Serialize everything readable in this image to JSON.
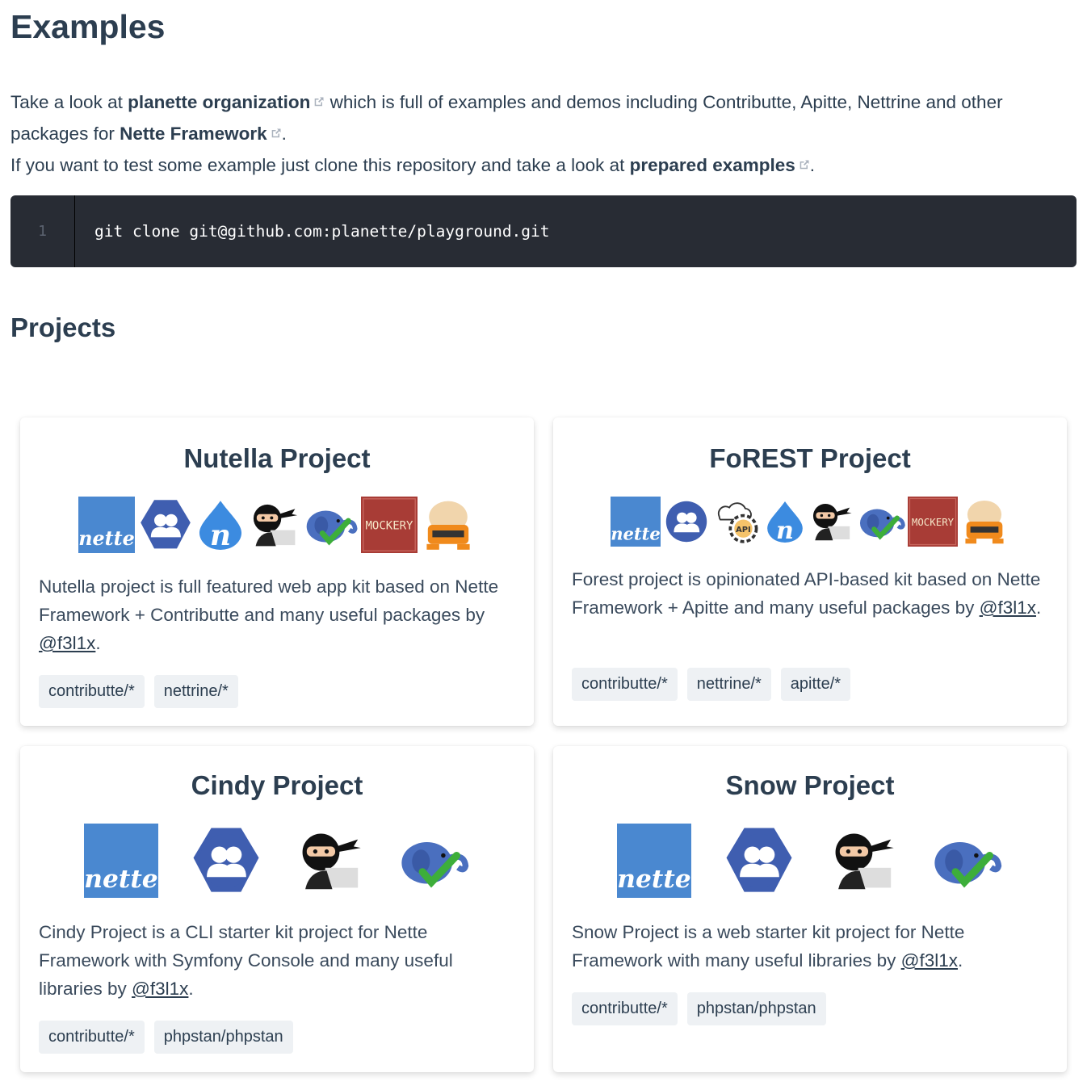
{
  "page": {
    "heading": "Examples",
    "intro": {
      "p1_a": "Take a look at ",
      "p1_link1": "planette organization",
      "p1_b": " which is full of examples and demos including Contributte, Apitte, Nettrine and other packages for ",
      "p1_link2": "Nette Framework",
      "p1_c": ".",
      "p2_a": "If you want to test some example just clone this repository and take a look at ",
      "p2_link": "prepared examples",
      "p2_b": "."
    },
    "code": {
      "line_number": "1",
      "text": "git clone git@github.com:planette/playground.git"
    },
    "projects_heading": "Projects"
  },
  "logo_texts": {
    "nette": "nette",
    "mockery": "MOCKERY",
    "api": "API",
    "n": "n"
  },
  "icons": [
    "external-link-icon",
    "nette-logo",
    "contributte-logo",
    "nettrine-logo",
    "apitte-logo",
    "ninja-logo",
    "phpstan-elephant-logo",
    "mockery-logo",
    "robot-logo"
  ],
  "colors": {
    "text": "#2c3e50",
    "code_bg": "#282c34",
    "tag_bg": "#eef1f4",
    "nette_blue": "#4a88d0",
    "contributte_blue": "#3f5eb0",
    "mockery_red": "#a83c36"
  },
  "cards": [
    {
      "title": "Nutella Project",
      "desc": "Nutella project is full featured web app kit based on Nette Framework + Contributte and many useful packages by ",
      "author": "@f3l1x",
      "end": ".",
      "tags": [
        "contributte/*",
        "nettrine/*"
      ]
    },
    {
      "title": "FoREST Project",
      "desc": "Forest project is opinionated API-based kit based on Nette Framework + Apitte and many useful packages by ",
      "author": "@f3l1x",
      "end": ".",
      "tags": [
        "contributte/*",
        "nettrine/*",
        "apitte/*"
      ]
    },
    {
      "title": "Cindy Project",
      "desc": "Cindy Project is a CLI starter kit project for Nette Framework with Symfony Console and many useful libraries by ",
      "author": "@f3l1x",
      "end": ".",
      "tags": [
        "contributte/*",
        "phpstan/phpstan"
      ]
    },
    {
      "title": "Snow Project",
      "desc": "Snow Project is a web starter kit project for Nette Framework with many useful libraries by ",
      "author": "@f3l1x",
      "end": ".",
      "tags": [
        "contributte/*",
        "phpstan/phpstan"
      ]
    }
  ]
}
